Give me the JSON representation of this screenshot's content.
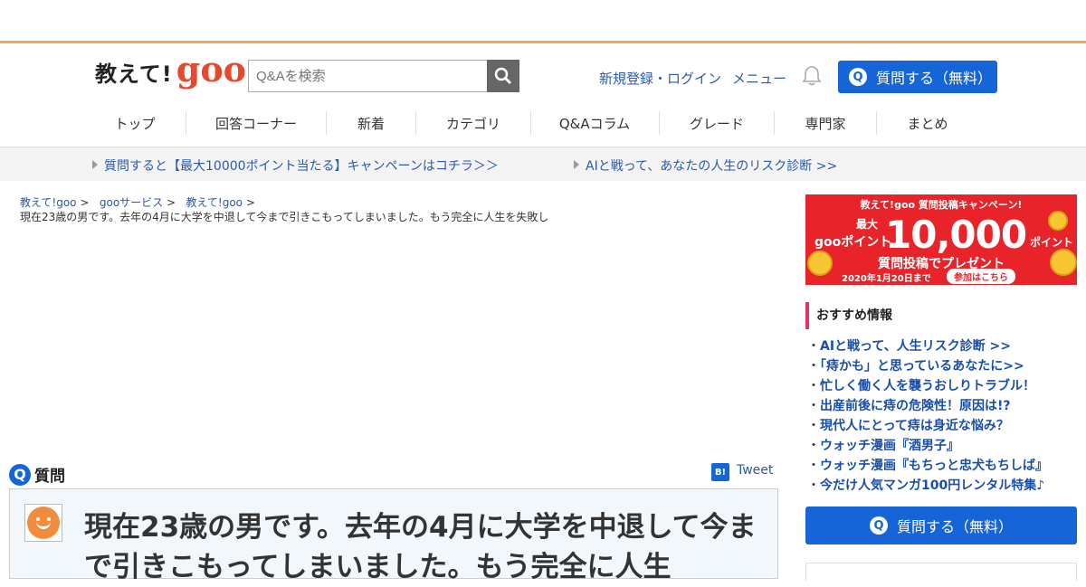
{
  "header": {
    "logo_text": "教えて!",
    "logo_brand": "goo",
    "search_placeholder": "Q&Aを検索",
    "login_link": "新規登録・ログイン",
    "menu_link": "メニュー",
    "ask_button": "質問する（無料）"
  },
  "nav": {
    "items": [
      "トップ",
      "回答コーナー",
      "新着",
      "カテゴリ",
      "Q&Aコラム",
      "グレード",
      "専門家",
      "まとめ"
    ]
  },
  "promo": {
    "link1": "質問すると【最大10000ポイント当たる】キャンペーンはコチラ＞＞",
    "link2": "AIと戦って、あなたの人生のリスク診断 >>"
  },
  "breadcrumb": {
    "items": [
      "教えて!goo",
      "gooサービス",
      "教えて!goo"
    ],
    "separator": ">",
    "current": "現在23歳の男です。去年の4月に大学を中退して今まで引きこもってしまいました。もう完全に人生を失敗し"
  },
  "question": {
    "label": "質問",
    "q_mark": "Q",
    "hatena": "B!",
    "tweet": "Tweet",
    "title": "現在23歳の男です。去年の4月に大学を中退して今まで引きこもってしまいました。もう完全に人生"
  },
  "banner": {
    "campaign": "教えて!goo 質問投稿キャンペーン!",
    "goo_point": "gooポイント",
    "max_label": "最大",
    "amount": "10,000",
    "point_unit": "ポイント",
    "sub": "質問投稿でプレゼント",
    "deadline": "2020年1月20日まで",
    "cta": "参加はこちら"
  },
  "recommended": {
    "heading": "おすすめ情報",
    "items": [
      "AIと戦って、人生リスク診断 >>",
      "「痔かも」と思っているあなたに>>",
      "忙しく働く人を襲うおしりトラブル！",
      "出産前後に痔の危険性！原因は!?",
      "現代人にとって痔は身近な悩み？",
      "ウォッチ漫画『酒男子』",
      "ウォッチ漫画『もちっと忠犬もちしば』",
      "今だけ人気マンガ100円レンタル特集♪"
    ]
  },
  "sidebar": {
    "ask_button": "質問する（無料）"
  },
  "colors": {
    "accent_blue": "#1565d8",
    "link_blue": "#2a5aa8",
    "brand_red": "#e8472c",
    "top_border": "#f4a460"
  }
}
